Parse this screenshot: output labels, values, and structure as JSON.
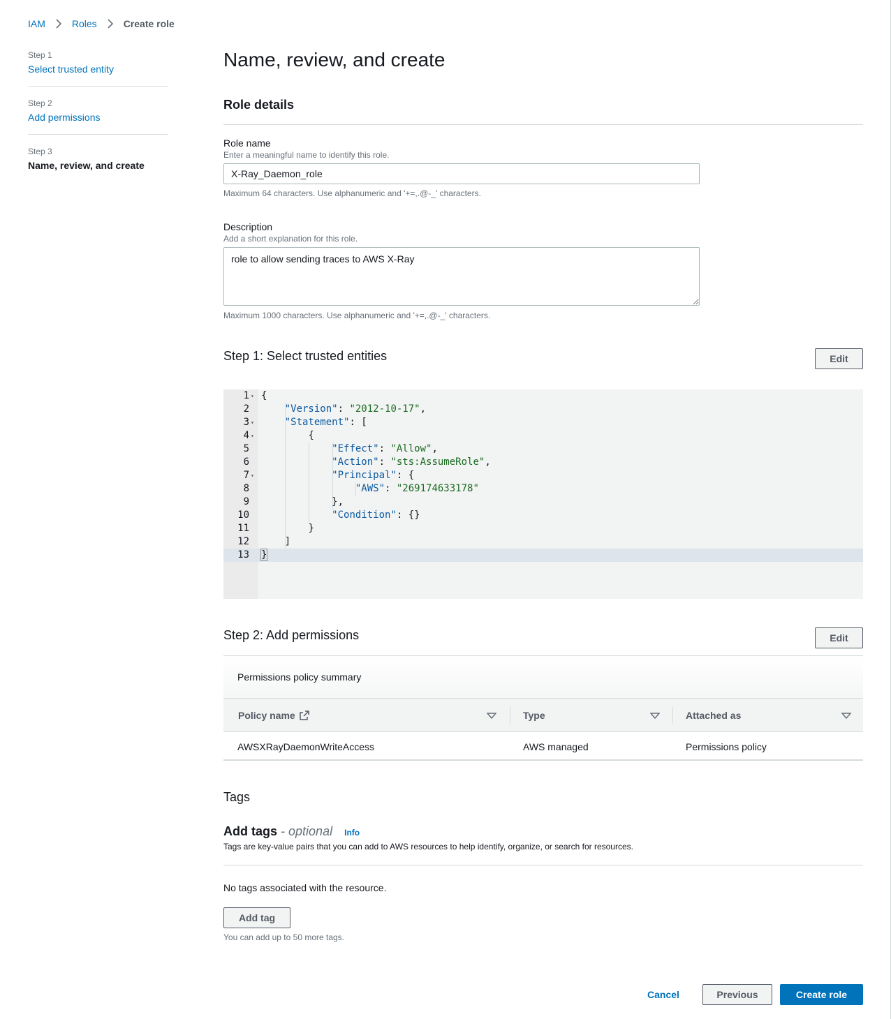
{
  "breadcrumb": {
    "items": [
      "IAM",
      "Roles",
      "Create role"
    ]
  },
  "steps": [
    {
      "num": "Step 1",
      "label": "Select trusted entity"
    },
    {
      "num": "Step 2",
      "label": "Add permissions"
    },
    {
      "num": "Step 3",
      "label": "Name, review, and create"
    }
  ],
  "page_title": "Name, review, and create",
  "role_details": {
    "header": "Role details",
    "role_name_label": "Role name",
    "role_name_desc": "Enter a meaningful name to identify this role.",
    "role_name_value": "X-Ray_Daemon_role",
    "role_name_hint": "Maximum 64 characters. Use alphanumeric and '+=,.@-_' characters.",
    "description_label": "Description",
    "description_desc": "Add a short explanation for this role.",
    "description_value": "role to allow sending traces to AWS X-Ray",
    "description_hint": "Maximum 1000 characters. Use alphanumeric and '+=,.@-_' characters."
  },
  "step1": {
    "title": "Step 1: Select trusted entities",
    "edit_label": "Edit"
  },
  "policy_json": {
    "version_key": "\"Version\"",
    "version_val": "\"2012-10-17\"",
    "statement_key": "\"Statement\"",
    "effect_key": "\"Effect\"",
    "effect_val": "\"Allow\"",
    "action_key": "\"Action\"",
    "action_val": "\"sts:AssumeRole\"",
    "principal_key": "\"Principal\"",
    "aws_key": "\"AWS\"",
    "aws_val": "\"269174633178\"",
    "condition_key": "\"Condition\""
  },
  "step2": {
    "title": "Step 2: Add permissions",
    "edit_label": "Edit",
    "summary_title": "Permissions policy summary",
    "columns": [
      "Policy name",
      "Type",
      "Attached as"
    ],
    "rows": [
      {
        "policy_name": "AWSXRayDaemonWriteAccess",
        "type": "AWS managed",
        "attached_as": "Permissions policy"
      }
    ]
  },
  "tags": {
    "title": "Tags",
    "add_tags_title": "Add tags",
    "optional_label": "- optional",
    "info_label": "Info",
    "description": "Tags are key-value pairs that you can add to AWS resources to help identify, organize, or search for resources.",
    "empty_text": "No tags associated with the resource.",
    "add_tag_label": "Add tag",
    "limit_hint": "You can add up to 50 more tags."
  },
  "footer": {
    "cancel_label": "Cancel",
    "previous_label": "Previous",
    "create_label": "Create role"
  },
  "colors": {
    "link": "#0073bb",
    "primary": "#0073bb",
    "string": "#1c6b21",
    "key": "#0b5aa0"
  }
}
